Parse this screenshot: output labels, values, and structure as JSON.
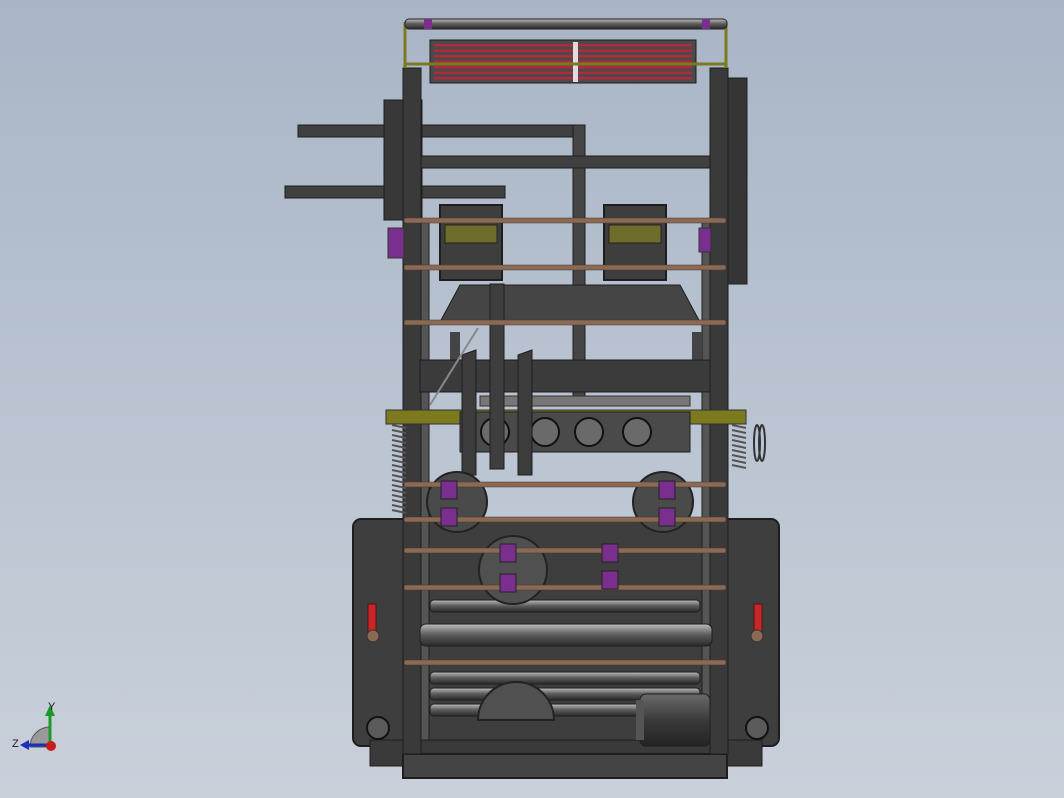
{
  "viewport": {
    "background_top": "#a9b5c6",
    "background_bottom": "#c9d0da"
  },
  "colors": {
    "frame": "#3d3d3d",
    "frame_dark": "#2c2c2c",
    "rod": "#8a6a55",
    "roller_red": "#b3283a",
    "accent_purple": "#7a2f8f",
    "accent_olive": "#7b7a1e",
    "metal_light": "#9a9a9a"
  },
  "triad": {
    "x_label": "",
    "y_label": "Y",
    "z_label": "Z"
  }
}
